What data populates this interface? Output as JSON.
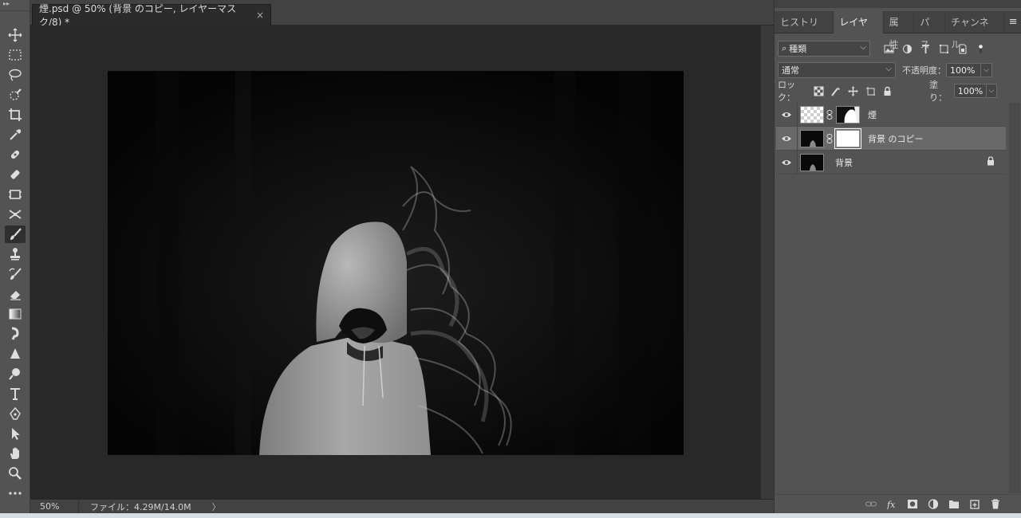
{
  "document": {
    "tab_title": "煙.psd @ 50% (背景 のコピー, レイヤーマスク/8) *",
    "close_glyph": "×"
  },
  "status": {
    "zoom": "50%",
    "file_info": "ファイル：4.29M/14.0M",
    "arrow": "〉"
  },
  "panel": {
    "tabs": [
      {
        "label": "ヒストリー",
        "active": false
      },
      {
        "label": "レイヤー",
        "active": true
      },
      {
        "label": "属性",
        "active": false
      },
      {
        "label": "パス",
        "active": false
      },
      {
        "label": "チャンネル",
        "active": false
      }
    ],
    "menu_glyph": "≡",
    "filter_kind": "種類",
    "blend_mode": "通常",
    "opacity_label": "不透明度：",
    "opacity_value": "100%",
    "lock_label": "ロック：",
    "fill_label": "塗り：",
    "fill_value": "100%"
  },
  "layers": [
    {
      "name": "煙",
      "visible": true,
      "selected": false,
      "has_mask": true,
      "locked": false
    },
    {
      "name": "背景 のコピー",
      "visible": true,
      "selected": true,
      "has_mask": true,
      "locked": false
    },
    {
      "name": "背景",
      "visible": true,
      "selected": false,
      "has_mask": false,
      "locked": true
    }
  ],
  "tools": [
    "move-tool",
    "marquee-tool",
    "lasso-tool",
    "quick-selection-tool",
    "crop-tool",
    "eyedropper-tool",
    "spot-healing-tool",
    "brush-tool",
    "stamp-tool",
    "history-brush-tool",
    "eraser-tool",
    "gradient-tool",
    "blur-tool",
    "dodge-tool",
    "pen-tool",
    "type-tool",
    "path-selection-tool",
    "shape-tool",
    "hand-tool",
    "zoom-tool",
    "more-tools"
  ],
  "active_tool": "brush-tool",
  "colors": {
    "panel_bg": "#535353",
    "canvas_bg": "#282828",
    "selected_layer": "#696969"
  }
}
